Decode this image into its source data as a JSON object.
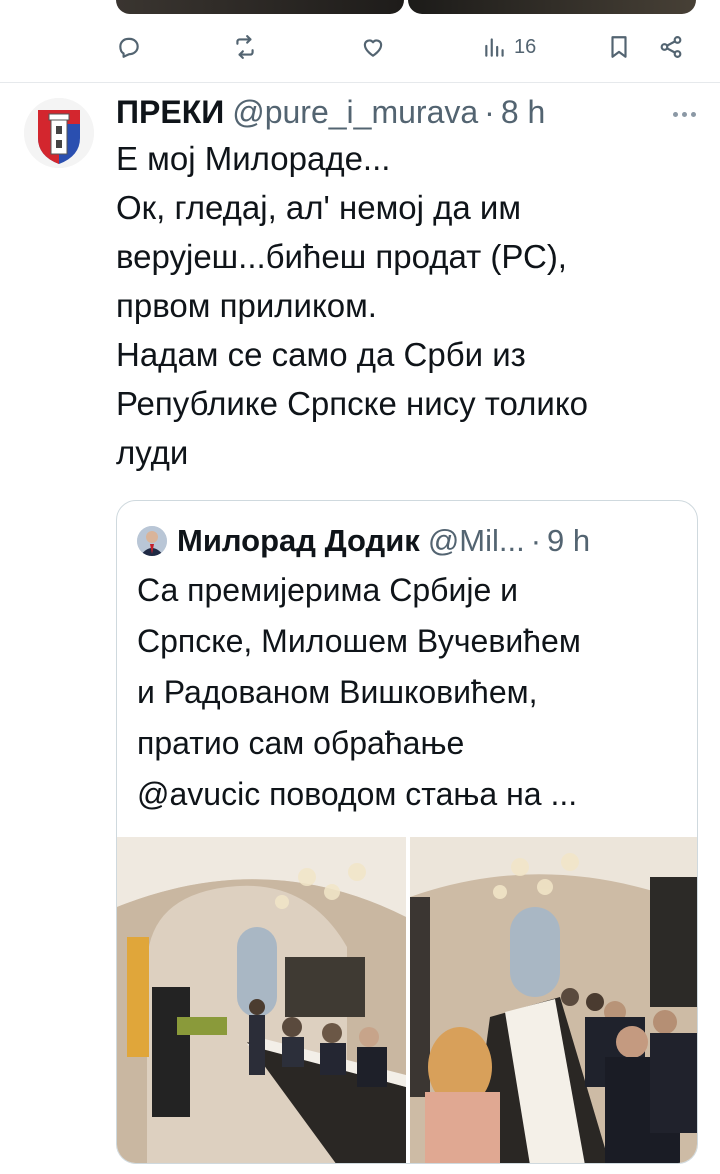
{
  "prev_tweet": {
    "actions": {
      "reply_icon": "reply-icon",
      "retweet_icon": "retweet-icon",
      "like_icon": "heart-icon",
      "views_icon": "views-icon",
      "views_count": "16",
      "bookmark_icon": "bookmark-icon",
      "share_icon": "share-icon"
    }
  },
  "tweet": {
    "author_name": "ПРЕКИ",
    "author_handle": "@pure_i_murava",
    "separator": "·",
    "time": "8 h",
    "text_lines": [
      "Е мој Милораде...",
      "Ок, гледај, ал' немој да им",
      "верујеш...бићеш продат (РС),",
      "првом приликом.",
      "Надам се само да Срби из",
      "Републике Српске нису толико",
      "луди"
    ]
  },
  "quote": {
    "author_name": "Милорад Додик",
    "author_handle": "@Mil...",
    "separator": "·",
    "time": "9 h",
    "text_lines": [
      "Са премијерима Србије и",
      "Српске, Милошем Вучевићем",
      "и Радованом Вишковићем,",
      "пратио сам обраћање",
      "@avucic поводом стања на ..."
    ],
    "photos": [
      "restaurant-meeting-photo-1",
      "restaurant-meeting-photo-2"
    ]
  },
  "colors": {
    "text": "#0f1419",
    "secondary": "#536471",
    "border": "#cfd9de"
  }
}
